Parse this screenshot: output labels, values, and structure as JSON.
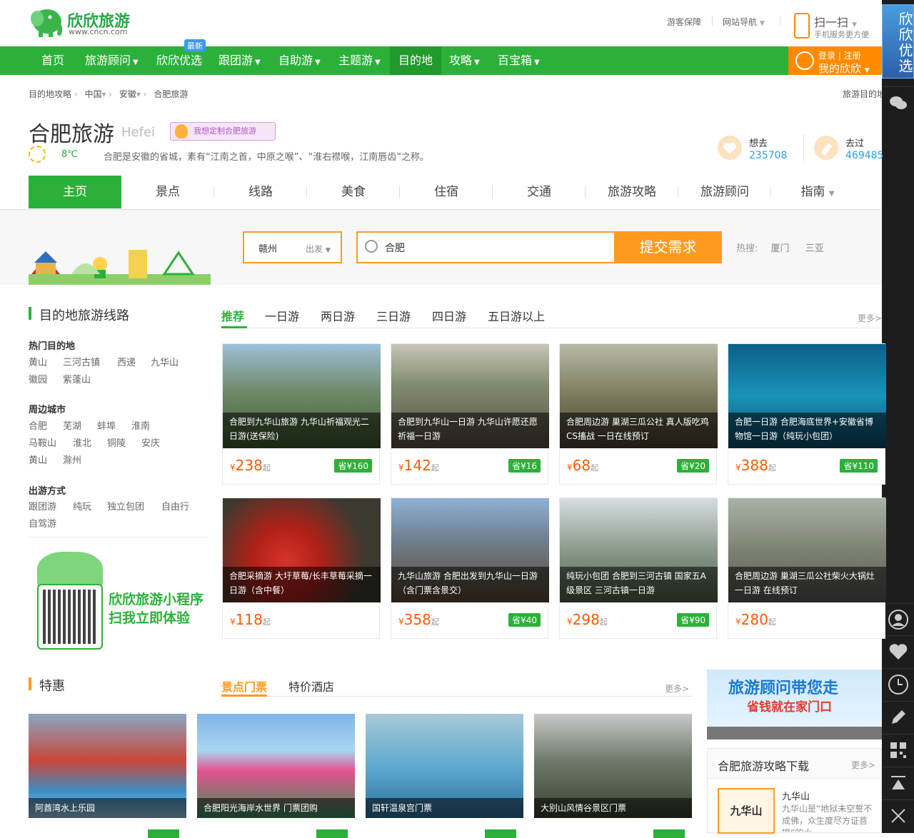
{
  "brand": {
    "name": "欣欣旅游",
    "url": "www.cncn.com",
    "color": "#2bb139",
    "accent": "#ff9a1f"
  },
  "toplinks": {
    "guarantee": "游客保障",
    "sitenav": "网站导航"
  },
  "scan": {
    "title": "扫一扫",
    "sub": "手机服务更方便"
  },
  "nav": {
    "items": [
      "首页",
      "旅游顾问",
      "欣欣优选",
      "跟团游",
      "自助游",
      "主题游",
      "目的地",
      "攻略",
      "百宝箱"
    ],
    "badge": "最新"
  },
  "login": {
    "l1": "登录 | 注册",
    "l2": "我的欣欣"
  },
  "rbar": {
    "promo": "欣欣优选",
    "icons": [
      "wechat-icon",
      "user-icon",
      "heart-icon",
      "clock-icon",
      "edit-icon",
      "qrcode-icon",
      "back-to-top-icon",
      "close-icon"
    ]
  },
  "breadcrumb": [
    "目的地攻略",
    "中国",
    "安徽",
    "合肥旅游"
  ],
  "breadcrumb_right": "旅游目的地",
  "city": {
    "name": "合肥旅游",
    "en": "Hefei",
    "custom": "我想定制合肥旅游",
    "temp": "8℃",
    "desc": "合肥是安徽的省城，素有“江南之首，中原之喉”、“淮右襟喉，江南唇齿”之称。"
  },
  "stats": {
    "want_label": "想去",
    "want": "235708",
    "been_label": "去过",
    "been": "469485"
  },
  "tabs": [
    "主页",
    "景点",
    "线路",
    "美食",
    "住宿",
    "交通",
    "旅游攻略",
    "旅游顾问",
    "指南"
  ],
  "search": {
    "depart_city": "赣州",
    "depart_label": "出发",
    "value": "合肥",
    "submit": "提交需求",
    "hot_label": "热搜:",
    "hot": [
      "厦门",
      "三亚"
    ]
  },
  "routes": {
    "title": "目的地旅游线路",
    "subtabs": [
      "推荐",
      "一日游",
      "两日游",
      "三日游",
      "四日游",
      "五日游以上"
    ],
    "more": "更多>",
    "filters": [
      {
        "title": "热门目的地",
        "links": [
          "黄山",
          "三河古镇",
          "西递",
          "九华山",
          "徽园",
          "紫蓬山"
        ]
      },
      {
        "title": "周边城市",
        "links": [
          "合肥",
          "芜湖",
          "蚌埠",
          "淮南",
          "马鞍山",
          "淮北",
          "铜陵",
          "安庆",
          "黄山",
          "滁州"
        ]
      },
      {
        "title": "出游方式",
        "links": [
          "跟团游",
          "纯玩",
          "独立包团",
          "自由行",
          "自驾游"
        ]
      }
    ],
    "mini": {
      "t1": "欣欣旅游小程序",
      "t2": "扫我立即体验"
    },
    "cards": [
      {
        "cap": "合肥到九华山旅游 九华山祈福观光二日游(送保险)",
        "price": "238",
        "save": "省¥160",
        "bg": "linear-gradient(180deg,#9fc0d8 0%,#6e8a6a 45%,#3e5a2e 100%)"
      },
      {
        "cap": "合肥到九华山一日游 九华山许愿还愿祈福一日游",
        "price": "142",
        "save": "省¥16",
        "bg": "linear-gradient(180deg,#c9c4b8 0%,#7f8a6e 40%,#5a4f40 100%)"
      },
      {
        "cap": "合肥周边游 巢湖三瓜公社 真人版吃鸡CS搐战 一日在线预订",
        "price": "68",
        "save": "省¥20",
        "bg": "linear-gradient(180deg,#b8b9a8 0%,#7b7a5c 50%,#4a3e30 100%)"
      },
      {
        "cap": "合肥一日游 合肥海底世界+安徽省博物馆一日游（纯玩小包团）",
        "price": "388",
        "save": "省¥110",
        "bg": "linear-gradient(180deg,#0b5f8a 0%,#1a93b8 50%,#0a4a6c 100%)"
      },
      {
        "cap": "合肥采摘游 大圩草莓/长丰草莓采摘一日游（含中餐）",
        "price": "118",
        "save": "",
        "bg": "radial-gradient(circle at 40% 60%,#d6332a 0%,#b02018 30%,#3d3a30 70%)"
      },
      {
        "cap": "九华山旅游 合肥出发到九华山一日游（含门票含景交）",
        "price": "358",
        "save": "省¥40",
        "bg": "linear-gradient(180deg,#8fb0d6 0%,#6f7f8e 40%,#5c4834 100%)"
      },
      {
        "cap": "纯玩小包团 合肥到三河古镇 国家五A级景区 三河古镇一日游",
        "price": "298",
        "save": "省¥90",
        "bg": "linear-gradient(180deg,#d7dde0 0%,#8a9a8a 50%,#4f5f48 100%)"
      },
      {
        "cap": "合肥周边游 巢湖三瓜公社柴火大锅灶一日游 在线预订",
        "price": "280",
        "save": "",
        "bg": "linear-gradient(180deg,#a9b2a6 0%,#7c8272 50%,#5a5a52 100%)"
      }
    ]
  },
  "deals": {
    "title": "特惠",
    "subtabs": [
      "景点门票",
      "特价酒店"
    ],
    "more": "更多>",
    "cards": [
      {
        "cap": "阿酋湾水上乐园",
        "bg": "linear-gradient(180deg,#8aa7c2 0%,#c9463b 45%,#3a8fc7 75%,#9bc7e0 100%)"
      },
      {
        "cap": "合肥阳光海岸水世界 门票团购",
        "bg": "linear-gradient(180deg,#7fb4e8 0%,#a8d6f0 35%,#e4528e 55%,#3a8f5a 100%)"
      },
      {
        "cap": "国轩温泉宫门票",
        "bg": "linear-gradient(180deg,#a8c9d8 0%,#5faad0 50%,#2d6f9a 100%)"
      },
      {
        "cap": "大别山风情谷景区门票",
        "bg": "linear-gradient(180deg,#c8c8c8 0%,#6f7a6a 45%,#38402f 100%)"
      }
    ]
  },
  "ad": {
    "a1": "旅游顾问带您走",
    "a2": "省钱就在家门口"
  },
  "download": {
    "title": "合肥旅游攻略下载",
    "more": "更多>",
    "book": "九华山",
    "bname": "九华山",
    "bdesc": "九华山是“地狱未空誓不成佛，众生度尽方证菩提”的大"
  }
}
